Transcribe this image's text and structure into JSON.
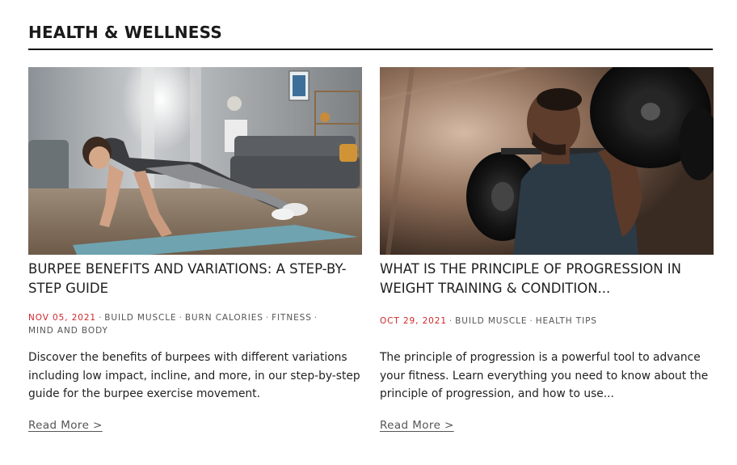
{
  "section": {
    "title": "HEALTH & WELLNESS"
  },
  "articles": [
    {
      "image_icon": "woman-plank-photo",
      "title": "BURPEE BENEFITS AND VARIATIONS: A STEP-BY-STEP GUIDE",
      "date": "NOV 05, 2021",
      "categories": [
        "BUILD MUSCLE",
        "BURN CALORIES",
        "FITNESS",
        "MIND AND BODY"
      ],
      "excerpt": "Discover the benefits of burpees with different variations including low impact, incline, and more, in our step-by-step guide for the burpee exercise movement.",
      "read_more": "Read More >"
    },
    {
      "image_icon": "man-barbell-photo",
      "title": "WHAT IS THE PRINCIPLE OF PROGRESSION IN WEIGHT TRAINING & CONDITION...",
      "date": "OCT 29, 2021",
      "categories": [
        "BUILD MUSCLE",
        "HEALTH TIPS"
      ],
      "excerpt": "The principle of progression is a powerful tool to advance your fitness. Learn everything you need to know about the principle of progression, and how to use...",
      "read_more": "Read More >"
    }
  ],
  "colors": {
    "date_accent": "#d0262b",
    "rule": "#111111",
    "meta_text": "#555555"
  },
  "separator": "·"
}
